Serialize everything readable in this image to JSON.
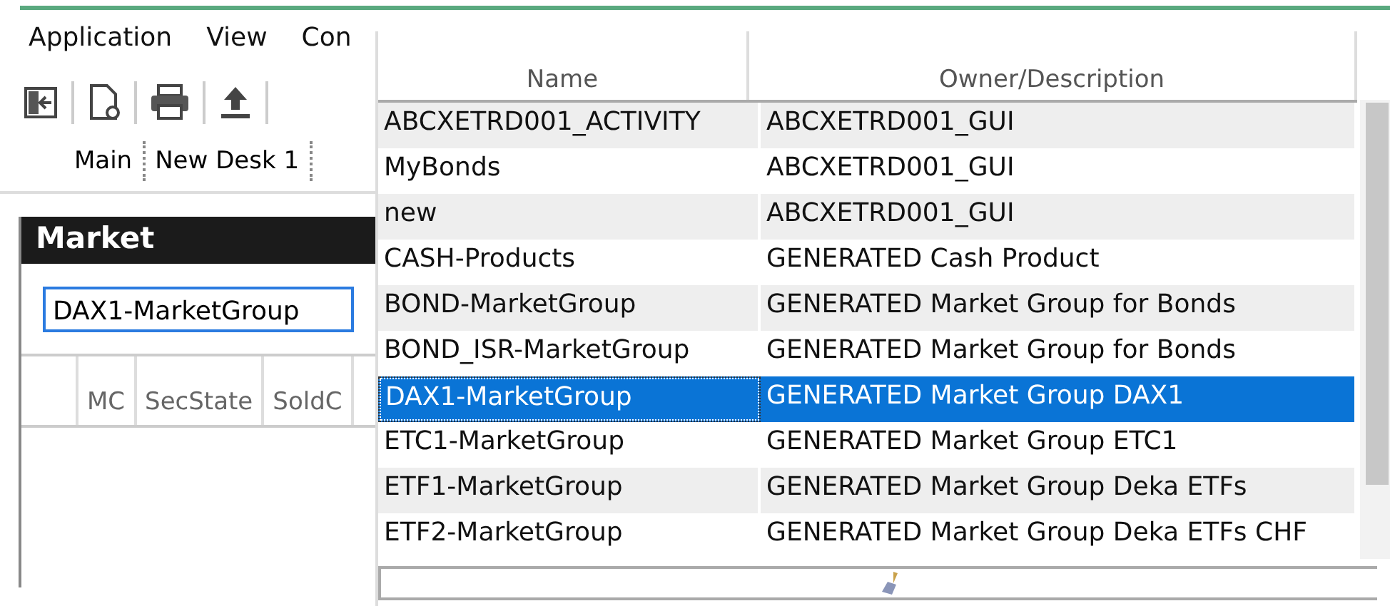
{
  "menu": [
    "Application",
    "View",
    "Con"
  ],
  "desk_tabs": [
    {
      "label": "Main",
      "selected": false
    },
    {
      "label": "New Desk 1",
      "selected": false
    }
  ],
  "market": {
    "title": "Market",
    "field_value": "DAX1-MarketGroup",
    "columns": [
      "",
      "MC",
      "SecState",
      "SoldC"
    ]
  },
  "popup": {
    "columns": [
      "Name",
      "Owner/Description"
    ],
    "rows": [
      {
        "name": "ABCXETRD001_ACTIVITY",
        "owner": "ABCXETRD001_GUI",
        "selected": false
      },
      {
        "name": "MyBonds",
        "owner": "ABCXETRD001_GUI",
        "selected": false
      },
      {
        "name": "new",
        "owner": "ABCXETRD001_GUI",
        "selected": false
      },
      {
        "name": "CASH-Products",
        "owner": "GENERATED Cash Product",
        "selected": false
      },
      {
        "name": "BOND-MarketGroup",
        "owner": "GENERATED Market Group for Bonds",
        "selected": false
      },
      {
        "name": "BOND_ISR-MarketGroup",
        "owner": "GENERATED Market Group for Bonds",
        "selected": false
      },
      {
        "name": "DAX1-MarketGroup",
        "owner": "GENERATED Market Group DAX1",
        "selected": true
      },
      {
        "name": "ETC1-MarketGroup",
        "owner": "GENERATED Market Group ETC1",
        "selected": false
      },
      {
        "name": "ETF1-MarketGroup",
        "owner": "GENERATED Market Group Deka ETFs",
        "selected": false
      },
      {
        "name": "ETF2-MarketGroup",
        "owner": "GENERATED Market Group Deka ETFs CHF",
        "selected": false
      }
    ]
  }
}
